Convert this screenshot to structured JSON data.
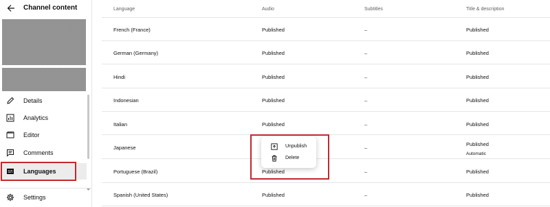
{
  "sidebar": {
    "title": "Channel content",
    "back_icon": "arrow-left-icon",
    "items": [
      {
        "label": "Details",
        "icon": "pencil-icon"
      },
      {
        "label": "Analytics",
        "icon": "bar-chart-icon"
      },
      {
        "label": "Editor",
        "icon": "clapperboard-icon"
      },
      {
        "label": "Comments",
        "icon": "comment-icon"
      },
      {
        "label": "Languages",
        "icon": "subtitles-icon",
        "active": true
      },
      {
        "label": "Settings",
        "icon": "gear-icon"
      }
    ]
  },
  "table": {
    "headers": {
      "language": "Language",
      "audio": "Audio",
      "subtitles": "Subtitles",
      "title": "Title & description"
    },
    "rows": [
      {
        "language": "French (France)",
        "audio": "Published",
        "subtitles": "–",
        "title": "Published"
      },
      {
        "language": "German (Germany)",
        "audio": "Published",
        "subtitles": "–",
        "title": "Published"
      },
      {
        "language": "Hindi",
        "audio": "Published",
        "subtitles": "–",
        "title": "Published"
      },
      {
        "language": "Indonesian",
        "audio": "Published",
        "subtitles": "–",
        "title": "Published"
      },
      {
        "language": "Italian",
        "audio": "Published",
        "subtitles": "–",
        "title": "Published"
      },
      {
        "language": "Japanese",
        "audio": "",
        "subtitles": "–",
        "title": "Published",
        "title_sub": "Automatic"
      },
      {
        "language": "Portuguese (Brazil)",
        "audio": "Published",
        "subtitles": "–",
        "title": "Published"
      },
      {
        "language": "Spanish (United States)",
        "audio": "Published",
        "subtitles": "–",
        "title": "Published"
      }
    ]
  },
  "popup_menu": {
    "items": [
      {
        "label": "Unpublish",
        "icon": "unpublish-icon"
      },
      {
        "label": "Delete",
        "icon": "trash-icon"
      }
    ]
  },
  "colors": {
    "highlight": "#c1272d",
    "active_bg": "#ececec",
    "divider": "#e5e5e5"
  }
}
